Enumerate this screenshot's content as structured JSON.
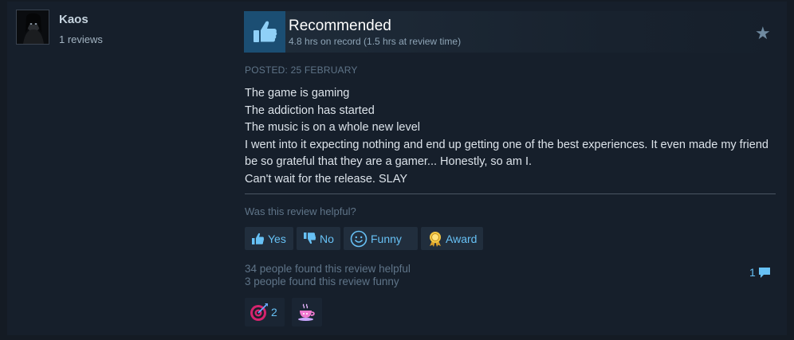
{
  "author": {
    "name": "Kaos",
    "reviews": "1 reviews"
  },
  "recommendation": {
    "title": "Recommended",
    "hours": "4.8 hrs on record (1.5 hrs at review time)"
  },
  "posted": "POSTED: 25 FEBRUARY",
  "review_lines": [
    "The game is gaming",
    "The addiction has started",
    "The music is on a whole new level",
    "I went into it expecting nothing and end up getting one of the best experiences. It even made my friend be so grateful that they are a gamer... Honestly, so am I.",
    "Can't wait for the release. SLAY"
  ],
  "helpful_question": "Was this review helpful?",
  "buttons": {
    "yes": "Yes",
    "no": "No",
    "funny": "Funny",
    "award": "Award"
  },
  "stats": {
    "helpful": "34 people found this review helpful",
    "funny": "3 people found this review funny"
  },
  "comments": {
    "count": "1"
  },
  "awards": [
    {
      "icon": "target-award-icon",
      "count": "2"
    },
    {
      "icon": "tea-cup-award-icon",
      "count": ""
    }
  ],
  "colors": {
    "background": "#141b24",
    "card": "#161f2b",
    "accent": "#67c1f5",
    "thumb_tile": "#1b4e73"
  }
}
